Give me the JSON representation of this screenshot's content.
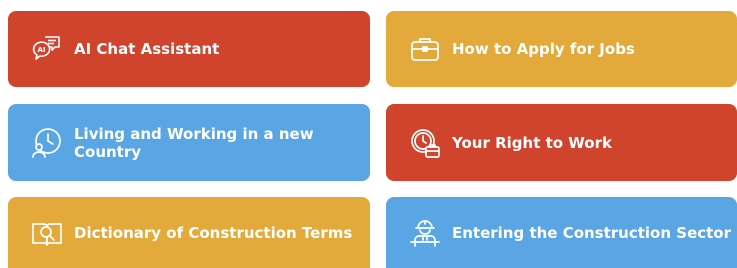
{
  "colors": {
    "red": "#d0432d",
    "yellow": "#e3a93a",
    "blue": "#5aa5e3"
  },
  "tiles": [
    {
      "label": "AI Chat Assistant",
      "icon": "chat-ai-icon",
      "color": "#d0432d"
    },
    {
      "label": "How to Apply for Jobs",
      "icon": "briefcase-icon",
      "color": "#e3a93a"
    },
    {
      "label": "Living and Working in a new Country",
      "icon": "clock-person-icon",
      "color": "#5aa5e3"
    },
    {
      "label": "Your Right to Work",
      "icon": "clock-briefcase-icon",
      "color": "#d0432d"
    },
    {
      "label": "Dictionary of Construction Terms",
      "icon": "dictionary-icon",
      "color": "#e3a93a"
    },
    {
      "label": "Entering the Construction Sector",
      "icon": "construction-worker-icon",
      "color": "#5aa5e3"
    }
  ]
}
